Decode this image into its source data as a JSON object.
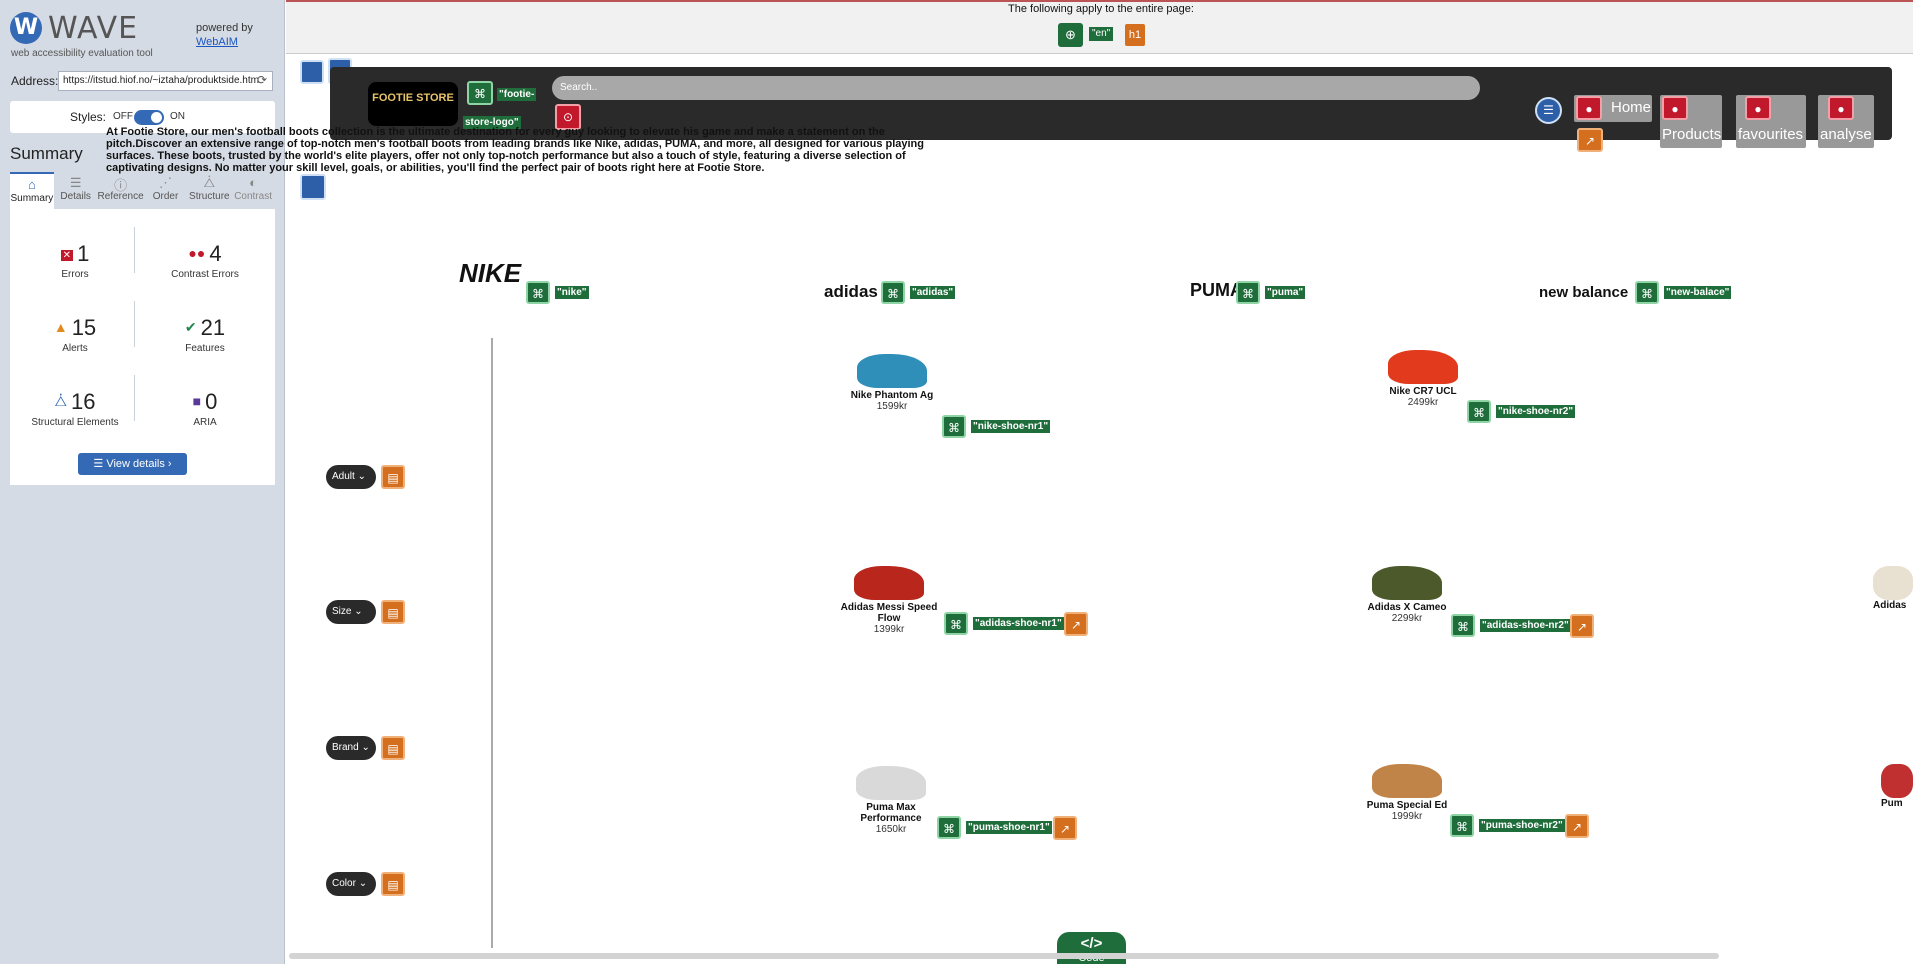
{
  "sidebar": {
    "logo_letter": "W",
    "app_name": "WAVE",
    "tagline": "web accessibility evaluation tool",
    "powered_by": "powered by",
    "webaim_link": "WebAIM",
    "address_label": "Address:",
    "address_value": "https://itstud.hiof.no/~iztaha/produktside.htm",
    "styles_label": "Styles:",
    "styles_off": "OFF",
    "styles_on": "ON",
    "summary_heading": "Summary",
    "tabs": [
      {
        "label": "Summary",
        "icon": "home-icon"
      },
      {
        "label": "Details",
        "icon": "list-icon"
      },
      {
        "label": "Reference",
        "icon": "info-icon"
      },
      {
        "label": "Order",
        "icon": "order-icon"
      },
      {
        "label": "Structure",
        "icon": "structure-icon"
      },
      {
        "label": "Contrast",
        "icon": "contrast-icon"
      }
    ],
    "stats": {
      "errors": {
        "count": "1",
        "label": "Errors"
      },
      "contrast_errors": {
        "count": "4",
        "label": "Contrast Errors"
      },
      "alerts": {
        "count": "15",
        "label": "Alerts"
      },
      "features": {
        "count": "21",
        "label": "Features"
      },
      "structural": {
        "count": "16",
        "label": "Structural Elements"
      },
      "aria": {
        "count": "0",
        "label": "ARIA"
      }
    },
    "view_details": "View details ›"
  },
  "notice": {
    "text": "The following apply to the entire page:",
    "lang": "\"en\"",
    "h1": "h1"
  },
  "site": {
    "logo_text": "FOOTIE STORE",
    "logo_alt_1": "\"footie-",
    "logo_alt_2": "store-logo\"",
    "search_placeholder": "Search..",
    "nav": [
      "Home",
      "Products",
      "favourites",
      "analyse"
    ],
    "intro": "At Footie Store, our men's football boots collection is the ultimate destination for every guy looking to elevate his game and make a statement on the pitch.Discover an extensive range of top-notch men's football boots from leading brands like Nike, adidas, PUMA, and more, all designed for various playing surfaces. These boots, trusted by the world's elite players, offer not only top-notch performance but also a touch of style, featuring a diverse selection of captivating designs. No matter your skill level, goals, or abilities, you'll find the perfect pair of boots right here at Footie Store.",
    "brands": [
      {
        "logo": "NIKE",
        "alt": "\"nike\""
      },
      {
        "logo": "adidas",
        "alt": "\"adidas\""
      },
      {
        "logo": "PUMA",
        "alt": "\"puma\""
      },
      {
        "logo": "new balance",
        "alt": "\"new-balace\""
      }
    ],
    "filters": [
      "Adult",
      "Size",
      "Brand",
      "Color"
    ],
    "products": [
      {
        "name": "Nike Phantom Ag",
        "price": "1599kr",
        "alt": "\"nike-shoe-nr1\"",
        "color": "#2f8fb8"
      },
      {
        "name": "Nike CR7 UCL",
        "price": "2499kr",
        "alt": "\"nike-shoe-nr2\"",
        "color": "#e23a1c"
      },
      {
        "name": "Adidas Messi Speed Flow",
        "price": "1399kr",
        "alt": "\"adidas-shoe-nr1\"",
        "color": "#b8261c"
      },
      {
        "name": "Adidas X Cameo",
        "price": "2299kr",
        "alt": "\"adidas-shoe-nr2\"",
        "color": "#4c5a2b"
      },
      {
        "name": "Puma Max Performance",
        "price": "1650kr",
        "alt": "\"puma-shoe-nr1\"",
        "color": "#d9d9d9"
      },
      {
        "name": "Puma Special Ed",
        "price": "1999kr",
        "alt": "\"puma-shoe-nr2\"",
        "color": "#c08448"
      }
    ],
    "clipped_product_1": "Adidas",
    "clipped_product_2": "Pum"
  },
  "code_toggle": "Code",
  "code_icon": "</>"
}
